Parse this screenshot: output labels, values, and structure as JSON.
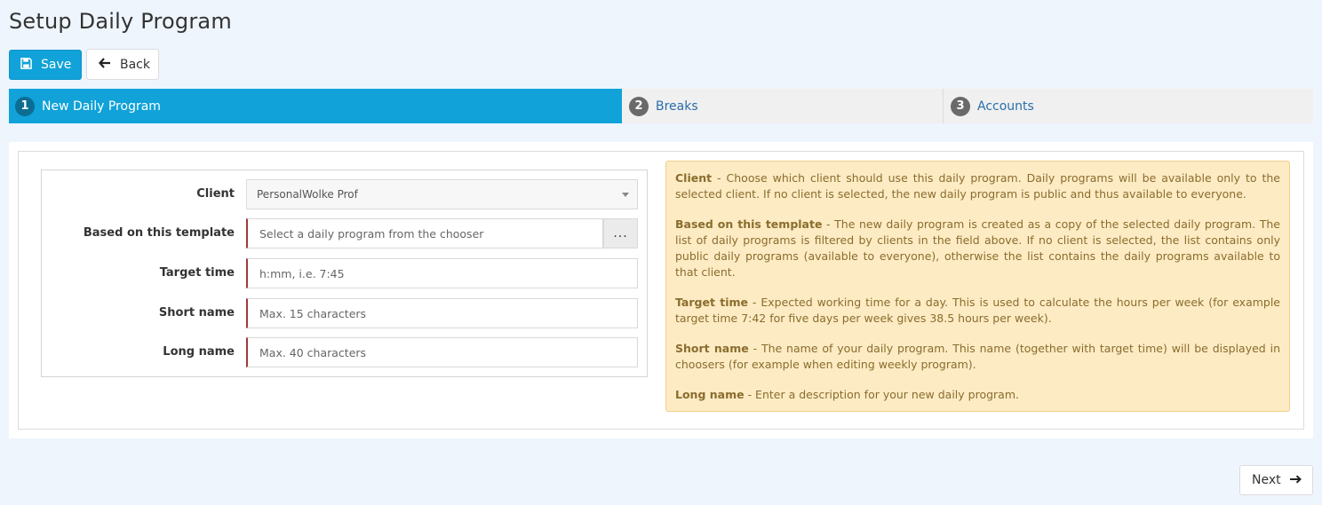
{
  "page": {
    "title": "Setup Daily Program"
  },
  "toolbar": {
    "save_label": "Save",
    "back_label": "Back"
  },
  "wizard": {
    "steps": [
      {
        "number": "1",
        "label": "New Daily Program"
      },
      {
        "number": "2",
        "label": "Breaks"
      },
      {
        "number": "3",
        "label": "Accounts"
      }
    ]
  },
  "form": {
    "client": {
      "label": "Client",
      "value": "PersonalWolke Prof"
    },
    "template": {
      "label": "Based on this template",
      "placeholder": "Select a daily program from the chooser",
      "chooser_label": "..."
    },
    "target_time": {
      "label": "Target time",
      "placeholder": "h:mm, i.e. 7:45"
    },
    "short_name": {
      "label": "Short name",
      "placeholder": "Max. 15 characters"
    },
    "long_name": {
      "label": "Long name",
      "placeholder": "Max. 40 characters"
    }
  },
  "help": [
    {
      "term": "Client",
      "text": " - Choose which client should use this daily program. Daily programs will be available only to the selected client. If no client is selected, the new daily program is public and thus available to everyone."
    },
    {
      "term": "Based on this template",
      "text": " - The new daily program is created as a copy of the selected daily program. The list of daily programs is filtered by clients in the field above. If no client is selected, the list contains only public daily programs (available to everyone), otherwise the list contains the daily programs available to that client."
    },
    {
      "term": "Target time",
      "text": " - Expected working time for a day. This is used to calculate the hours per week (for example target time 7:42 for five days per week gives 38.5 hours per week)."
    },
    {
      "term": "Short name",
      "text": " - The name of your daily program. This name (together with target time) will be displayed in choosers (for example when editing weekly program)."
    },
    {
      "term": "Long name",
      "text": " - Enter a description for your new daily program."
    }
  ],
  "footer": {
    "next_label": "Next"
  },
  "colors": {
    "primary": "#10a2d8",
    "step_link": "#2a6eab",
    "help_bg": "#fdebc4",
    "help_text": "#8a6d2d",
    "required_marker": "#a33a3a"
  }
}
